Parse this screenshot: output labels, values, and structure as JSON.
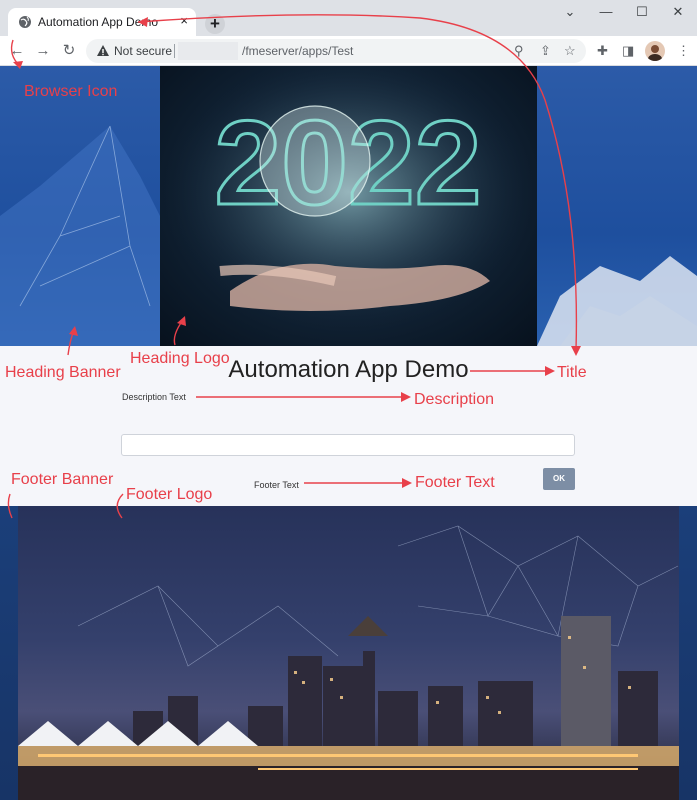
{
  "browser": {
    "tab_title": "Automation App Demo",
    "tab_close": "×",
    "new_tab": "+",
    "security_label": "Not secure",
    "url_path": "/fmeserver/apps/Test",
    "window_controls": {
      "chevron": "⌄",
      "minimize": "—",
      "maximize": "☐",
      "close": "✕"
    }
  },
  "page": {
    "title": "Automation App Demo",
    "description_text": "Description Text",
    "footer_text": "Footer Text",
    "ok_label": "OK",
    "heading_logo_year": "2022"
  },
  "annotations": {
    "browser_icon": "Browser Icon",
    "heading_banner": "Heading Banner",
    "heading_logo": "Heading Logo",
    "title": "Title",
    "description": "Description",
    "footer_banner": "Footer Banner",
    "footer_logo": "Footer Logo",
    "footer_text": "Footer Text"
  },
  "colors": {
    "annotation": "#e8404a",
    "heading_banner": "#2c5ba8",
    "ok_button": "#7d8ea5",
    "page_background": "#f5f6fa"
  },
  "icons": [
    "globe-icon",
    "close-icon",
    "plus-icon",
    "back-arrow-icon",
    "forward-arrow-icon",
    "reload-icon",
    "warning-icon",
    "zoom-icon",
    "share-icon",
    "star-icon",
    "extensions-icon",
    "sidepanel-icon",
    "avatar",
    "menu-icon"
  ]
}
